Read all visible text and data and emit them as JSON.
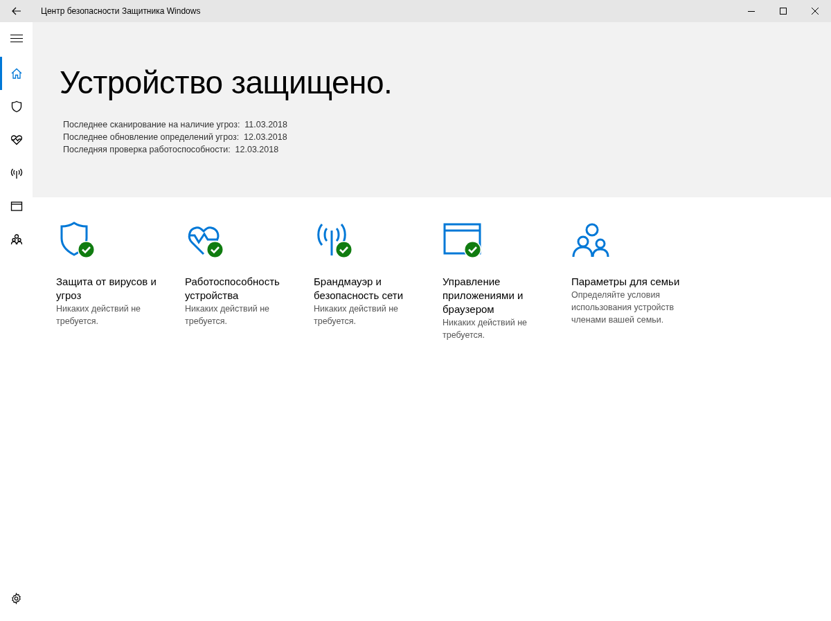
{
  "window": {
    "title": "Центр безопасности Защитника Windows"
  },
  "sidebar": {
    "items": [
      {
        "selected": true
      },
      {
        "selected": false
      },
      {
        "selected": false
      },
      {
        "selected": false
      },
      {
        "selected": false
      },
      {
        "selected": false
      }
    ]
  },
  "hero": {
    "heading": "Устройство защищено.",
    "lines": [
      "Последнее сканирование на наличие угроз:  11.03.2018",
      "Последнее обновление определений угроз:  12.03.2018",
      "Последняя проверка работоспособности:  12.03.2018"
    ]
  },
  "tiles": [
    {
      "title": "Защита от вирусов и угроз",
      "description": "Никаких действий не требуется.",
      "ok": true
    },
    {
      "title": "Работоспособность устройства",
      "description": "Никаких действий не требуется.",
      "ok": true
    },
    {
      "title": "Брандмауэр и безопасность сети",
      "description": "Никаких действий не требуется.",
      "ok": true
    },
    {
      "title": "Управление приложениями и браузером",
      "description": "Никаких действий не требуется.",
      "ok": true
    },
    {
      "title": "Параметры для семьи",
      "description": "Определяйте условия использования устройств членами вашей семьи.",
      "ok": false
    }
  ]
}
